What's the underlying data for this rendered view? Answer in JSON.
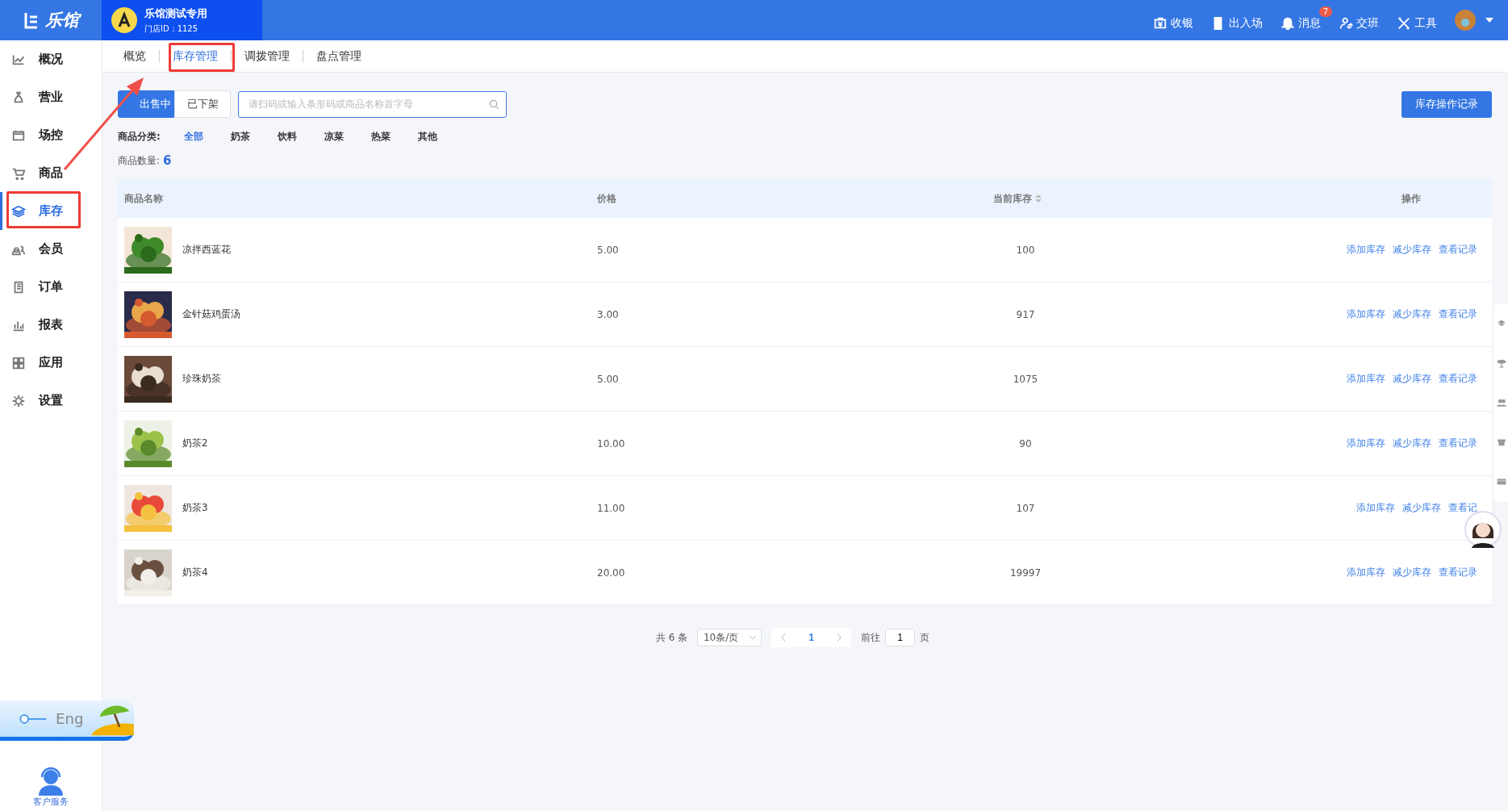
{
  "brand": {
    "logo": "乐馆"
  },
  "store": {
    "name": "乐馆测试专用",
    "id_label": "门店ID：1125"
  },
  "top_actions": [
    {
      "label": "收银",
      "kind": "cashier"
    },
    {
      "label": "出入场",
      "kind": "door"
    },
    {
      "label": "消息",
      "kind": "bell",
      "badge": "7"
    },
    {
      "label": "交班",
      "kind": "shift"
    },
    {
      "label": "工具",
      "kind": "tools"
    }
  ],
  "sidebar": {
    "items": [
      {
        "label": "概况",
        "kind": "chart",
        "selected": false
      },
      {
        "label": "营业",
        "kind": "bag",
        "selected": false
      },
      {
        "label": "场控",
        "kind": "calendar",
        "selected": false
      },
      {
        "label": "商品",
        "kind": "cart",
        "selected": false
      },
      {
        "label": "库存",
        "kind": "layers",
        "selected": true
      },
      {
        "label": "会员",
        "kind": "people",
        "selected": false
      },
      {
        "label": "订单",
        "kind": "book",
        "selected": false
      },
      {
        "label": "报表",
        "kind": "bars",
        "selected": false
      },
      {
        "label": "应用",
        "kind": "grid",
        "selected": false
      },
      {
        "label": "设置",
        "kind": "gear",
        "selected": false
      }
    ],
    "language": {
      "label": "Eng",
      "on": false
    },
    "service": "客户服务"
  },
  "tabs": [
    {
      "label": "概览",
      "selected": false
    },
    {
      "label": "库存管理",
      "selected": true
    },
    {
      "label": "调拨管理",
      "selected": false
    },
    {
      "label": "盘点管理",
      "selected": false
    }
  ],
  "status_toggle": [
    {
      "label": "出售中",
      "selected": true
    },
    {
      "label": "已下架",
      "selected": false
    }
  ],
  "search": {
    "placeholder": "请扫码或输入条形码或商品名称首字母"
  },
  "log_button": "库存操作记录",
  "categories": {
    "label": "商品分类:",
    "items": [
      {
        "label": "全部",
        "selected": true
      },
      {
        "label": "奶茶",
        "selected": false
      },
      {
        "label": "饮料",
        "selected": false
      },
      {
        "label": "凉菜",
        "selected": false
      },
      {
        "label": "热菜",
        "selected": false
      },
      {
        "label": "其他",
        "selected": false
      }
    ]
  },
  "count": {
    "label": "商品数量:",
    "value": "6"
  },
  "table": {
    "columns": [
      {
        "label": "商品名称",
        "sortable": false
      },
      {
        "label": "价格",
        "sortable": false
      },
      {
        "label": "当前库存",
        "sortable": true
      },
      {
        "label": "操作",
        "sortable": false
      }
    ],
    "rows": [
      {
        "name": "凉拌西蓝花",
        "price": "5.00",
        "stock": "100",
        "actions": [
          "添加库存",
          "减少库存",
          "查看记录"
        ]
      },
      {
        "name": "金针菇鸡蛋汤",
        "price": "3.00",
        "stock": "917",
        "actions": [
          "添加库存",
          "减少库存",
          "查看记录"
        ]
      },
      {
        "name": "珍珠奶茶",
        "price": "5.00",
        "stock": "1075",
        "actions": [
          "添加库存",
          "减少库存",
          "查看记录"
        ]
      },
      {
        "name": "奶茶2",
        "price": "10.00",
        "stock": "90",
        "actions": [
          "添加库存",
          "减少库存",
          "查看记录"
        ]
      },
      {
        "name": "奶茶3",
        "price": "11.00",
        "stock": "107",
        "actions": [
          "添加库存",
          "减少库存",
          "查看记"
        ]
      },
      {
        "name": "奶茶4",
        "price": "20.00",
        "stock": "19997",
        "actions": [
          "添加库存",
          "减少库存",
          "查看记录"
        ]
      }
    ]
  },
  "pagination": {
    "total": "共 6 条",
    "page_size": "10条/页",
    "pages": [
      {
        "label": "1",
        "selected": true
      }
    ],
    "goto_label": "前往",
    "goto_value": "1",
    "goto_suffix": "页"
  },
  "annotations": {
    "highlight_tab": true,
    "highlight_sidebar": true,
    "arrow": true
  }
}
